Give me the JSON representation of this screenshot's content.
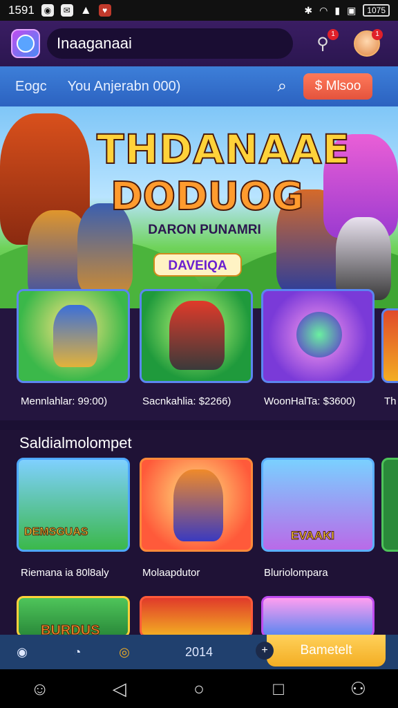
{
  "status_bar": {
    "time": "1591",
    "battery": "1075"
  },
  "app_bar": {
    "search_value": "Inaaganaai",
    "notification_count": "1",
    "avatar_badge": "1"
  },
  "search_strip": {
    "label": "Eogc",
    "input_value": "You Anjerabn 000)",
    "button_label": "Mlsoo"
  },
  "banner": {
    "title_line1": "THDANAAE",
    "title_line2": "DODUOG",
    "subtitle": "DARON PUNAMRI",
    "logo_text": "DAVEIQA"
  },
  "row1": {
    "items": [
      {
        "label": "Mennlahlar: 99:00)"
      },
      {
        "label": "Sacnkahlia: $2266)"
      },
      {
        "label": "WoonHalTa: $3600)"
      },
      {
        "label": "Th"
      }
    ]
  },
  "section": {
    "title": "Saldialmolompet"
  },
  "row2": {
    "items": [
      {
        "label": "Riemana ia 80l8aly",
        "art_text": "DEMSGUAS"
      },
      {
        "label": "Molaapdutor",
        "art_text": ""
      },
      {
        "label": "Bluriolompara",
        "art_text": "EVAAKI"
      }
    ]
  },
  "row3": {
    "items": [
      {
        "art_text": "BURDUS"
      },
      {
        "art_text": ""
      },
      {
        "art_text": ""
      }
    ]
  },
  "bottom_nav": {
    "center_label": "2014",
    "cta_label": "Bametelt"
  },
  "colors": {
    "accent": "#f3ad23",
    "app_bar": "#2b1650",
    "strip": "#3d7fd9",
    "card_border": "#5b86f0"
  }
}
